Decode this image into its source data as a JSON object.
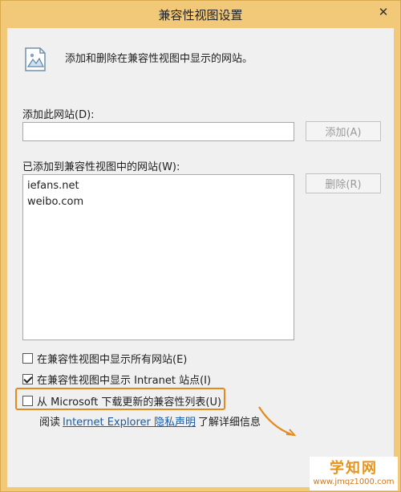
{
  "window": {
    "title": "兼容性视图设置",
    "close_glyph": "✕"
  },
  "header": {
    "description": "添加和删除在兼容性视图中显示的网站。",
    "icon": "site-image-icon"
  },
  "add_site": {
    "label": "添加此网站(D):",
    "value": "",
    "button": "添加(A)"
  },
  "site_list": {
    "label": "已添加到兼容性视图中的网站(W):",
    "items": [
      "iefans.net",
      "weibo.com"
    ],
    "remove_button": "删除(R)"
  },
  "options": {
    "show_all": {
      "label": "在兼容性视图中显示所有网站(E)",
      "checked": false
    },
    "show_intranet": {
      "label": "在兼容性视图中显示 Intranet 站点(I)",
      "checked": true
    },
    "download_list": {
      "label": "从 Microsoft 下载更新的兼容性列表(U)",
      "checked": false
    }
  },
  "privacy": {
    "prefix": "阅读",
    "link": "Internet Explorer 隐私声明",
    "suffix": "了解详细信息"
  },
  "watermark": {
    "name": "学知网",
    "url": "www.jmqz1000.com"
  },
  "colors": {
    "highlight": "#e28a1e",
    "link": "#1a5aa6",
    "frame": "#f2c879"
  }
}
